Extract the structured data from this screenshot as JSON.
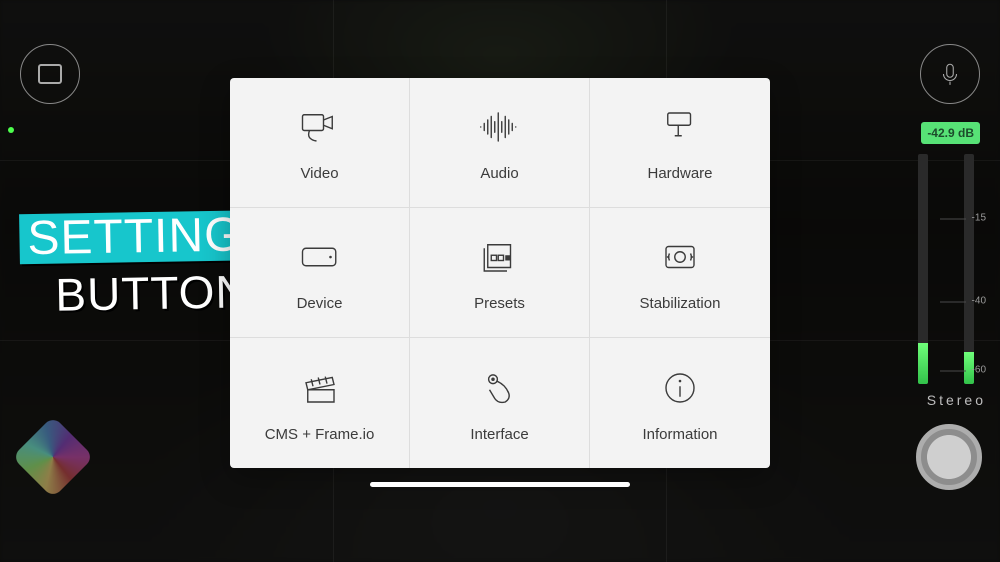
{
  "overlay_label": {
    "line1": "SETTINGS",
    "line2": "BUTTON"
  },
  "settings_grid": {
    "items": [
      {
        "label": "Video"
      },
      {
        "label": "Audio"
      },
      {
        "label": "Hardware"
      },
      {
        "label": "Device"
      },
      {
        "label": "Presets"
      },
      {
        "label": "Stabilization"
      },
      {
        "label": "CMS + Frame.io"
      },
      {
        "label": "Interface"
      },
      {
        "label": "Information"
      }
    ]
  },
  "audio_meter": {
    "db_value": "-42.9 dB",
    "mode": "Stereo",
    "ticks": [
      "-15",
      "-40",
      "-60"
    ]
  },
  "colors": {
    "accent_teal": "#17c6cc",
    "meter_green": "#57e276"
  }
}
